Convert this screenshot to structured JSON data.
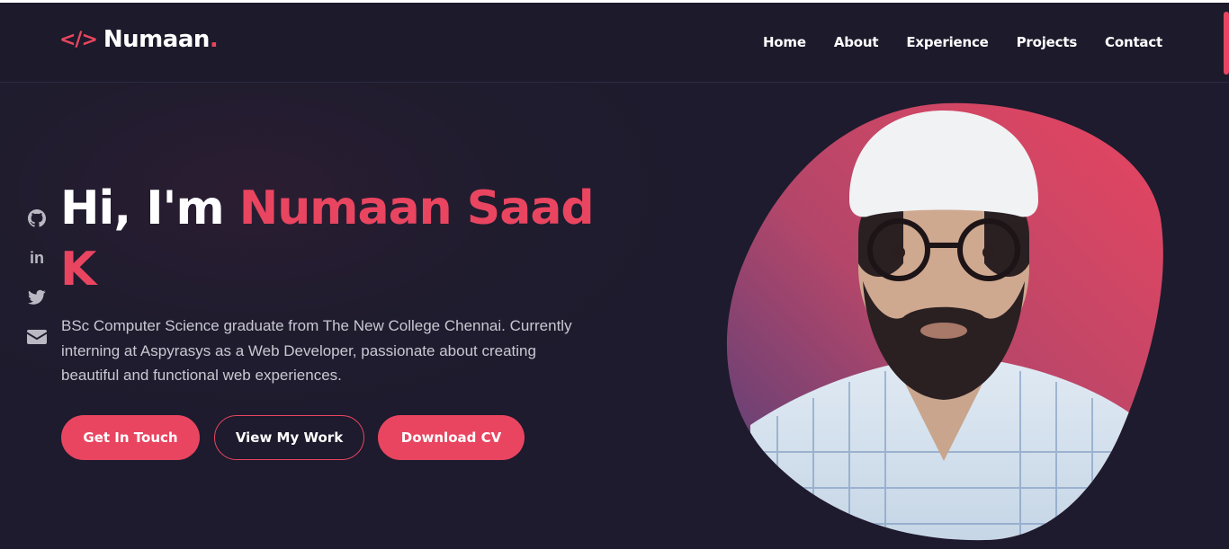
{
  "brand": {
    "code_symbol": "</>",
    "name": "Numaan",
    "dot": "."
  },
  "nav": {
    "items": [
      "Home",
      "About",
      "Experience",
      "Projects",
      "Contact"
    ]
  },
  "hero": {
    "greeting": "Hi, I'm ",
    "name": "Numaan Saad K",
    "bio": "BSc Computer Science graduate from The New College Chennai. Currently interning at Aspyrasys as a Web Developer, passionate about creating beautiful and functional web experiences.",
    "buttons": {
      "contact": "Get In Touch",
      "work": "View My Work",
      "cv": "Download CV"
    }
  },
  "socials": {
    "icons": [
      "github-icon",
      "linkedin-icon",
      "twitter-icon",
      "email-icon"
    ],
    "linkedin_glyph": "in"
  },
  "colors": {
    "accent": "#e94560",
    "background": "#1d1b2d",
    "navbar": "#1c1a2b",
    "text_muted": "#c9c8d2"
  }
}
